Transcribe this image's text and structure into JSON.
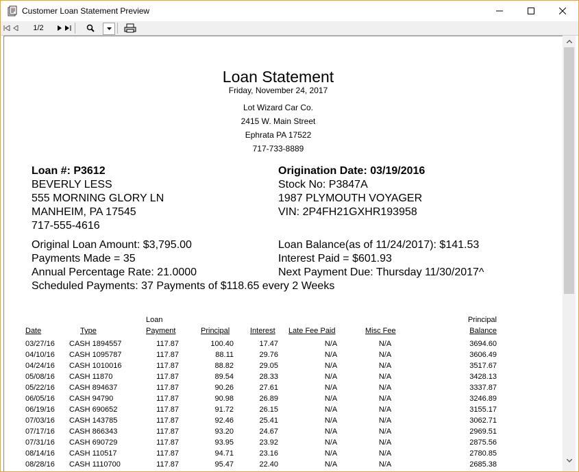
{
  "window": {
    "title": "Customer Loan Statement Preview"
  },
  "toolbar": {
    "page_indicator": "1/2"
  },
  "report": {
    "title": "Loan Statement",
    "date": "Friday, November 24, 2017",
    "company": [
      "Lot Wizard Car Co.",
      "2415 W. Main Street",
      "Ephrata PA 17522",
      "717-733-8889"
    ],
    "loan_number": "Loan #: P3612",
    "customer_name": "BEVERLY LESS",
    "address1": "555 MORNING GLORY LN",
    "address2": "MANHEIM, PA 17545",
    "phone": "717-555-4616",
    "origination_date": "Origination Date: 03/19/2016",
    "stock_no": "Stock No: P3847A",
    "vehicle": "1987 PLYMOUTH VOYAGER",
    "vin": "VIN: 2P4FH21GXHR193958",
    "original_amount": "Original Loan Amount: $3,795.00",
    "payments_made": "Payments Made = 35",
    "apr": "Annual Percentage Rate: 21.0000",
    "scheduled": "Scheduled Payments: 37 Payments of $118.65 every 2 Weeks",
    "loan_balance": "Loan Balance(as of 11/24/2017): $141.53",
    "interest_paid": "Interest Paid = $601.93",
    "next_due": "Next Payment Due: Thursday 11/30/2017^"
  },
  "table": {
    "headers": {
      "date": "Date",
      "type": "Type",
      "loan_payment_top": "Loan",
      "loan_payment": "Payment",
      "principal": "Principal",
      "interest": "Interest",
      "late_fee": "Late Fee Paid",
      "misc_fee": "Misc Fee",
      "balance_top": "Principal",
      "balance": "Balance"
    },
    "rows": [
      [
        "03/27/16",
        "CASH 1894557",
        "117.87",
        "100.40",
        "17.47",
        "N/A",
        "N/A",
        "3694.60"
      ],
      [
        "04/10/16",
        "CASH 1095787",
        "117.87",
        "88.11",
        "29.76",
        "N/A",
        "N/A",
        "3606.49"
      ],
      [
        "04/24/16",
        "CASH 1010016",
        "117.87",
        "88.82",
        "29.05",
        "N/A",
        "N/A",
        "3517.67"
      ],
      [
        "05/08/16",
        "CASH 11870",
        "117.87",
        "89.54",
        "28.33",
        "N/A",
        "N/A",
        "3428.13"
      ],
      [
        "05/22/16",
        "CASH 894637",
        "117.87",
        "90.26",
        "27.61",
        "N/A",
        "N/A",
        "3337.87"
      ],
      [
        "06/05/16",
        "CASH 94790",
        "117.87",
        "90.98",
        "26.89",
        "N/A",
        "N/A",
        "3246.89"
      ],
      [
        "06/19/16",
        "CASH 690652",
        "117.87",
        "91.72",
        "26.15",
        "N/A",
        "N/A",
        "3155.17"
      ],
      [
        "07/03/16",
        "CASH 143785",
        "117.87",
        "92.46",
        "25.41",
        "N/A",
        "N/A",
        "3062.71"
      ],
      [
        "07/17/16",
        "CASH 866343",
        "117.87",
        "93.20",
        "24.67",
        "N/A",
        "N/A",
        "2969.51"
      ],
      [
        "07/31/16",
        "CASH 690729",
        "117.87",
        "93.95",
        "23.92",
        "N/A",
        "N/A",
        "2875.56"
      ],
      [
        "08/14/16",
        "CASH 110517",
        "117.87",
        "94.71",
        "23.16",
        "N/A",
        "N/A",
        "2780.85"
      ],
      [
        "08/28/16",
        "CASH 1110700",
        "117.87",
        "95.47",
        "22.40",
        "N/A",
        "N/A",
        "2685.38"
      ]
    ]
  }
}
